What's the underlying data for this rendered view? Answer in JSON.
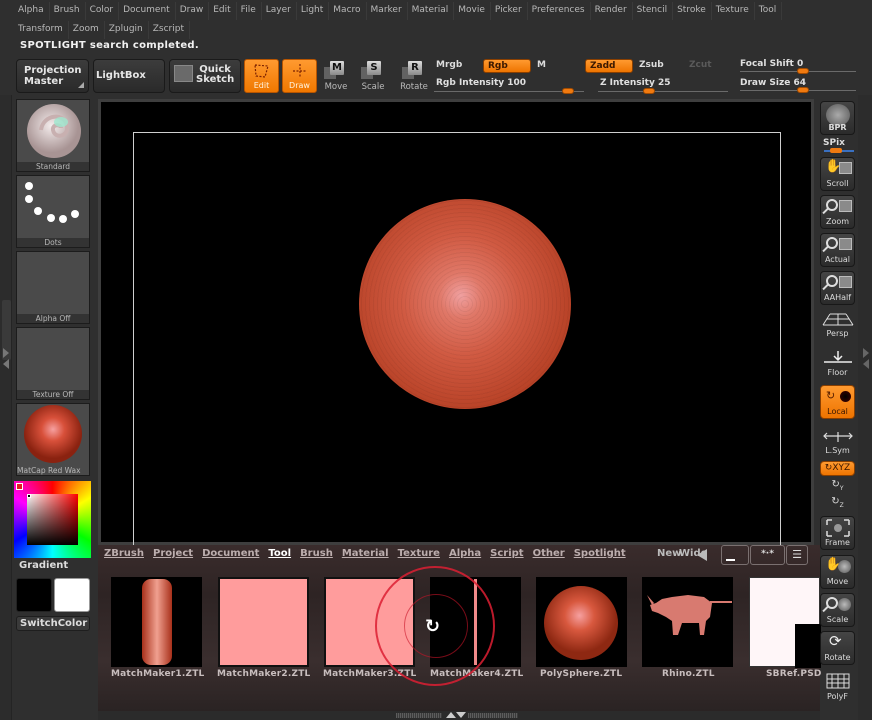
{
  "menus": {
    "row1": [
      "Alpha",
      "Brush",
      "Color",
      "Document",
      "Draw",
      "Edit",
      "File",
      "Layer",
      "Light",
      "Macro",
      "Marker",
      "Material",
      "Movie",
      "Picker",
      "Preferences",
      "Render",
      "Stencil",
      "Stroke",
      "Texture",
      "Tool"
    ],
    "row2": [
      "Transform",
      "Zoom",
      "Zplugin",
      "Zscript"
    ]
  },
  "status": "SPOTLIGHT search completed.",
  "toolbar": {
    "projection_master": [
      "Projection",
      "Master"
    ],
    "lightbox": "LightBox",
    "quick_sketch": [
      "Quick",
      "Sketch"
    ],
    "edit": "Edit",
    "draw": "Draw",
    "move": "Move",
    "move_key": "M",
    "scale": "Scale",
    "scale_key": "S",
    "rotate": "Rotate",
    "rotate_key": "R",
    "mrgb": "Mrgb",
    "rgb": "Rgb",
    "m": "M",
    "zadd": "Zadd",
    "zsub": "Zsub",
    "zcut": "Zcut",
    "rgb_intensity": {
      "label": "Rgb  Intensity",
      "value": "100",
      "fraction": 1.0
    },
    "z_intensity": {
      "label": "Z  Intensity",
      "value": "25",
      "fraction": 0.25
    },
    "focal_shift": {
      "label": "Focal  Shift",
      "value": "0",
      "fraction": 0.5
    },
    "draw_size": {
      "label": "Draw  Size",
      "value": "64",
      "fraction": 0.5
    }
  },
  "left_shelf": {
    "brush": "Standard",
    "stroke": "Dots",
    "alpha": "Alpha  Off",
    "texture": "Texture  Off",
    "material": "MatCap  Red  Wax",
    "gradient": "Gradient",
    "switch_color": "SwitchColor",
    "main_color": "#000000",
    "secondary_color": "#ffffff"
  },
  "lightbox": {
    "tabs": [
      "ZBrush",
      "Project",
      "Document",
      "Tool",
      "Brush",
      "Material",
      "Texture",
      "Alpha",
      "Script",
      "Other",
      "Spotlight"
    ],
    "active_tab": "Tool",
    "controls": {
      "new": "New",
      "wide": "Wide"
    },
    "items": [
      {
        "name": "MatchMaker1.ZTL"
      },
      {
        "name": "MatchMaker2.ZTL"
      },
      {
        "name": "MatchMaker3.ZTL"
      },
      {
        "name": "MatchMaker4.ZTL"
      },
      {
        "name": "PolySphere.ZTL"
      },
      {
        "name": "Rhino.ZTL"
      },
      {
        "name": "SBRef.PSD"
      }
    ]
  },
  "right_shelf": {
    "bpr": "BPR",
    "spix": "SPix",
    "scroll": "Scroll",
    "zoom": "Zoom",
    "actual": "Actual",
    "aahalf": "AAHalf",
    "persp": "Persp",
    "floor": "Floor",
    "local": "Local",
    "lsym": "L.Sym",
    "xyz": "XYZ",
    "y": "Y",
    "z": "Z",
    "frame": "Frame",
    "move": "Move",
    "scale": "Scale",
    "rotate": "Rotate",
    "polyf": "PolyF"
  },
  "colors": {
    "accent": "#f07800",
    "canvas_bg": "#000000",
    "model": "#c8503a"
  }
}
